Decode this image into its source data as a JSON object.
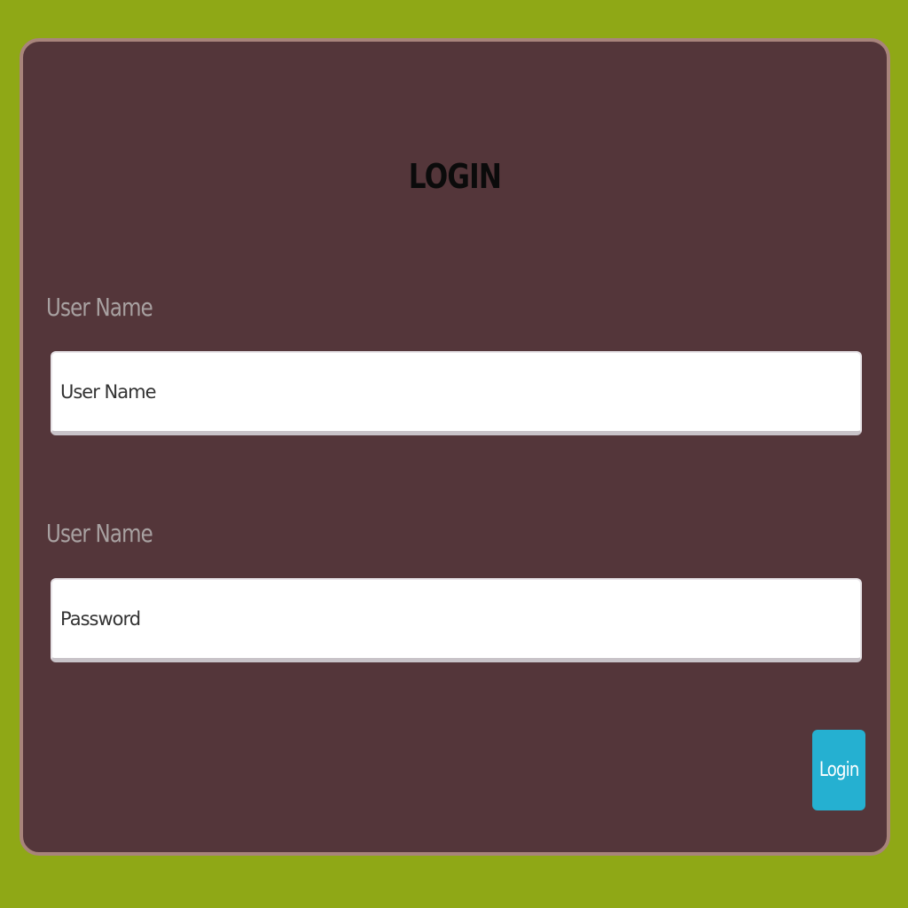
{
  "form": {
    "title": "LOGIN",
    "username_label": "User Name",
    "username_placeholder": "User Name",
    "username_value": "",
    "password_label": "User Name",
    "password_placeholder": "Password",
    "password_value": "",
    "submit_label": "Login"
  },
  "colors": {
    "page_background": "#8fa816",
    "card_background": "#54363a",
    "card_border": "#a8847b",
    "label_text": "#a8a1a1",
    "button_background": "#25b0d1"
  }
}
